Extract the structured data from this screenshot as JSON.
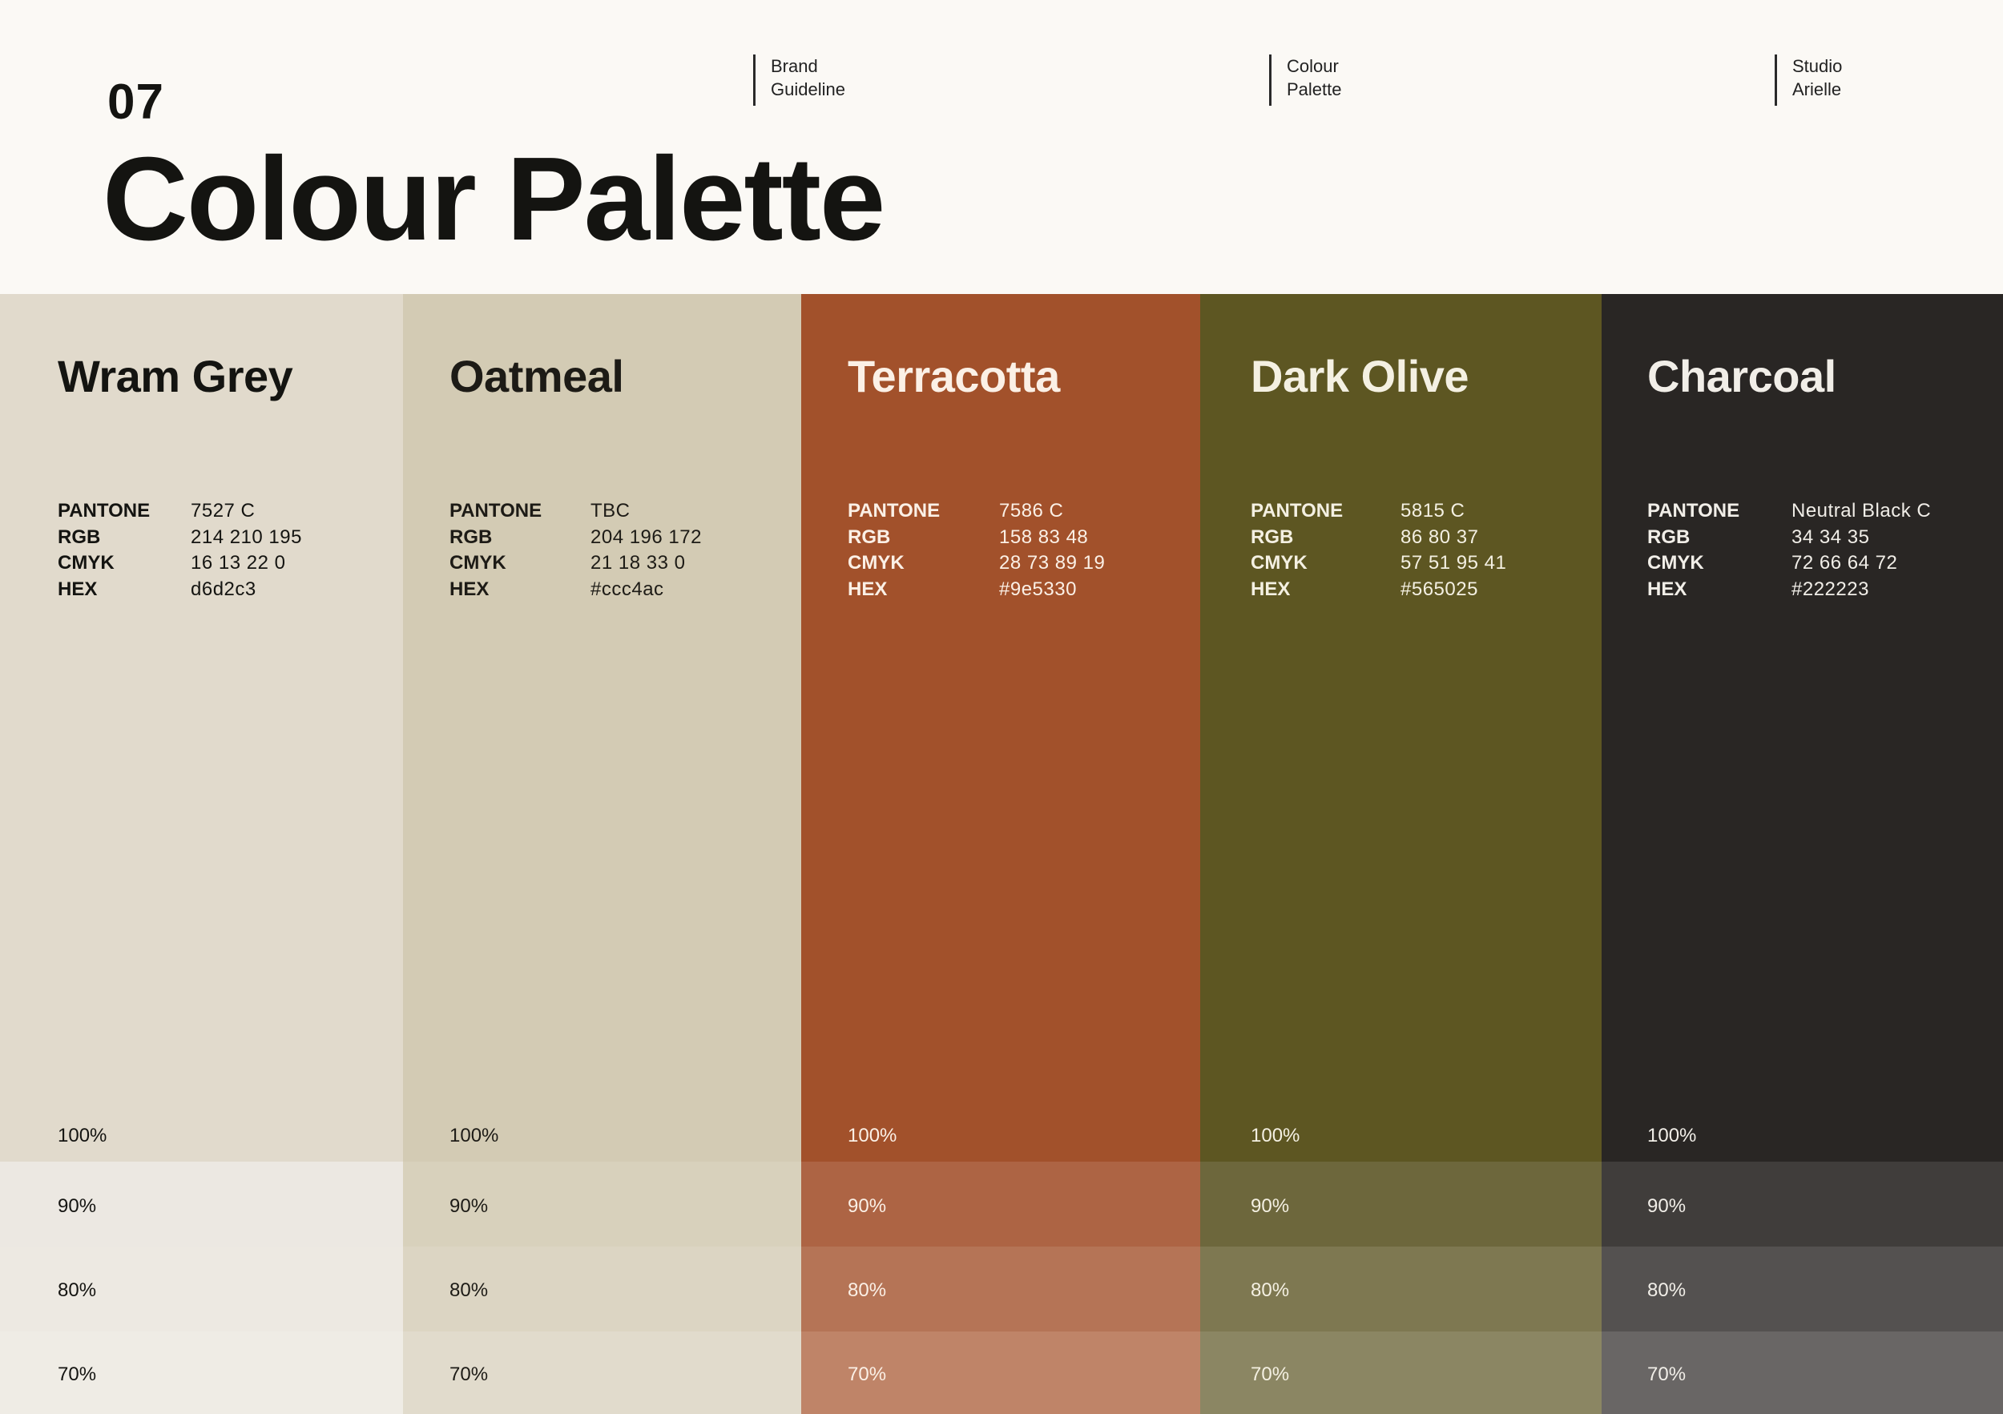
{
  "header": {
    "page_number": "07",
    "title": "Colour Palette",
    "meta": [
      {
        "line1": "Brand",
        "line2": "Guideline"
      },
      {
        "line1": "Colour",
        "line2": "Palette"
      },
      {
        "line1": "Studio",
        "line2": "Arielle"
      }
    ]
  },
  "spec_labels": {
    "pantone": "PANTONE",
    "rgb": "RGB",
    "cmyk": "CMYK",
    "hex": "HEX"
  },
  "tint_labels": [
    "100%",
    "90%",
    "80%",
    "70%"
  ],
  "colors": [
    {
      "name": "Wram Grey",
      "pantone": "7527 C",
      "rgb": "214  210  195",
      "cmyk": "16  13  22  0",
      "hex": "d6d2c3",
      "swatch": "#e1dacc",
      "text_color": "#141411",
      "tints": [
        "#ece8e2",
        "#ede9e2",
        "#efece5"
      ]
    },
    {
      "name": "Oatmeal",
      "pantone": "TBC",
      "rgb": "204  196 172",
      "cmyk": "21  18  33  0",
      "hex": "#ccc4ac",
      "swatch": "#d3cbb4",
      "text_color": "#1d1b16",
      "tints": [
        "#d8d1bc",
        "#dcd5c3",
        "#e1dbcc"
      ]
    },
    {
      "name": "Terracotta",
      "pantone": "7586  C",
      "rgb": "158  83  48",
      "cmyk": "28  73  89  19",
      "hex": "#9e5330",
      "swatch": "#a2512b",
      "text_color": "#fbf0e6",
      "tints": [
        "#ad6444",
        "#b57456",
        "#bf8468"
      ]
    },
    {
      "name": "Dark Olive",
      "pantone": "5815  C",
      "rgb": "86  80  37",
      "cmyk": "57  51  95  41",
      "hex": "#565025",
      "swatch": "#5d5622",
      "text_color": "#f4f0e2",
      "tints": [
        "#6d673c",
        "#7e7851",
        "#8b8663"
      ]
    },
    {
      "name": "Charcoal",
      "pantone": "Neutral Black C",
      "rgb": "34  34  35",
      "cmyk": "72  66  64  72",
      "hex": "#222223",
      "swatch": "#292624",
      "text_color": "#f1eee8",
      "tints": [
        "#403d3b",
        "#545150",
        "#696665"
      ]
    }
  ]
}
